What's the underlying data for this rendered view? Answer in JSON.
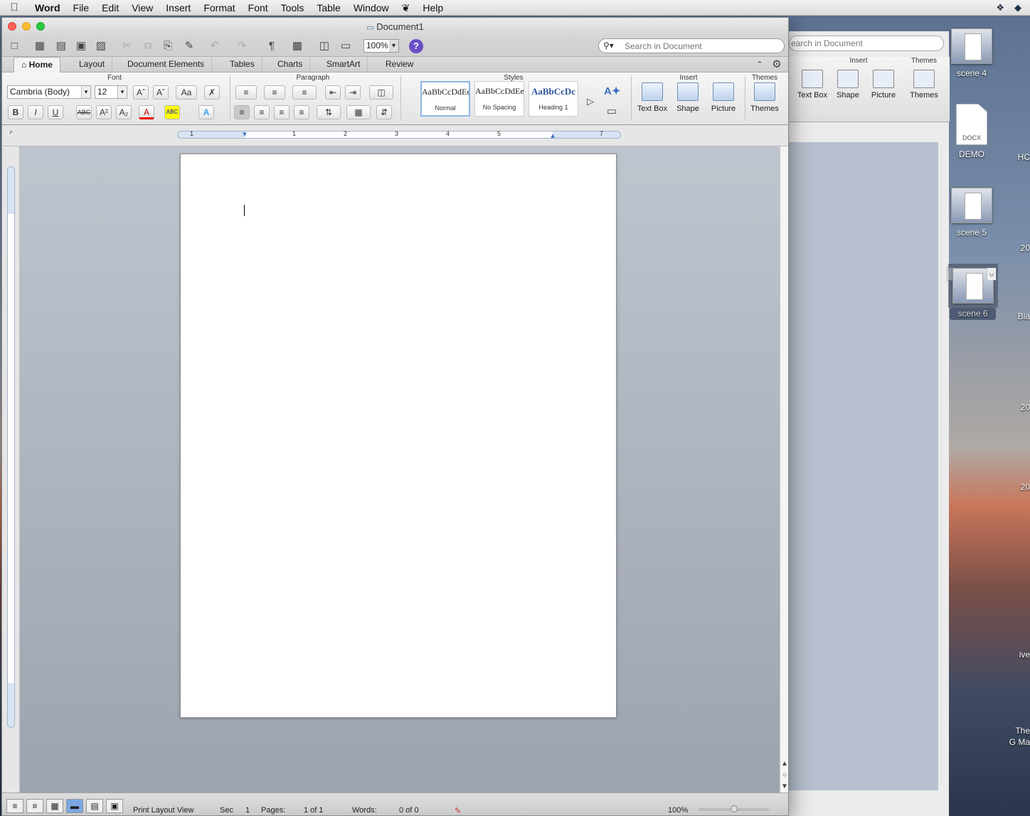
{
  "menubar": {
    "apple": "",
    "app": "Word",
    "items": [
      "File",
      "Edit",
      "View",
      "Insert",
      "Format",
      "Font",
      "Tools",
      "Table",
      "Window",
      "Help"
    ]
  },
  "window": {
    "title": "Document1"
  },
  "toolbar": {
    "zoom": "100%",
    "help": "?",
    "search_placeholder": "Search in Document"
  },
  "tabs": [
    "Home",
    "Layout",
    "Document Elements",
    "Tables",
    "Charts",
    "SmartArt",
    "Review"
  ],
  "ribbon": {
    "groups": {
      "font": "Font",
      "paragraph": "Paragraph",
      "styles": "Styles",
      "insert": "Insert",
      "themes": "Themes"
    },
    "font_name": "Cambria (Body)",
    "font_size": "12",
    "styles": [
      {
        "preview": "AaBbCcDdEe",
        "name": "Normal"
      },
      {
        "preview": "AaBbCcDdEe",
        "name": "No Spacing"
      },
      {
        "preview": "AaBbCcDc",
        "name": "Heading 1"
      }
    ],
    "insert": [
      "Text Box",
      "Shape",
      "Picture"
    ],
    "themes": "Themes"
  },
  "ruler": {
    "numbers": [
      "1",
      "1",
      "2",
      "3",
      "4",
      "5",
      "7"
    ]
  },
  "status": {
    "view": "Print Layout View",
    "sec_label": "Sec",
    "sec": "1",
    "pages_label": "Pages:",
    "pages": "1 of 1",
    "words_label": "Words:",
    "words": "0 of 0",
    "zoom": "100%"
  },
  "background_window": {
    "search": "earch in Document",
    "insert": "Insert",
    "themes": "Themes",
    "buttons": [
      "Text Box",
      "Shape",
      "Picture",
      "Themes"
    ]
  },
  "desktop": {
    "icons": [
      {
        "label": "scene 4"
      },
      {
        "label": "DEMO",
        "kind": "DOCX"
      },
      {
        "label": "scene 5"
      },
      {
        "label": "scene 6"
      }
    ],
    "edge_labels": [
      "HC",
      "20",
      "Bla",
      "20",
      "20",
      "ive",
      "The",
      "G Ma"
    ]
  }
}
